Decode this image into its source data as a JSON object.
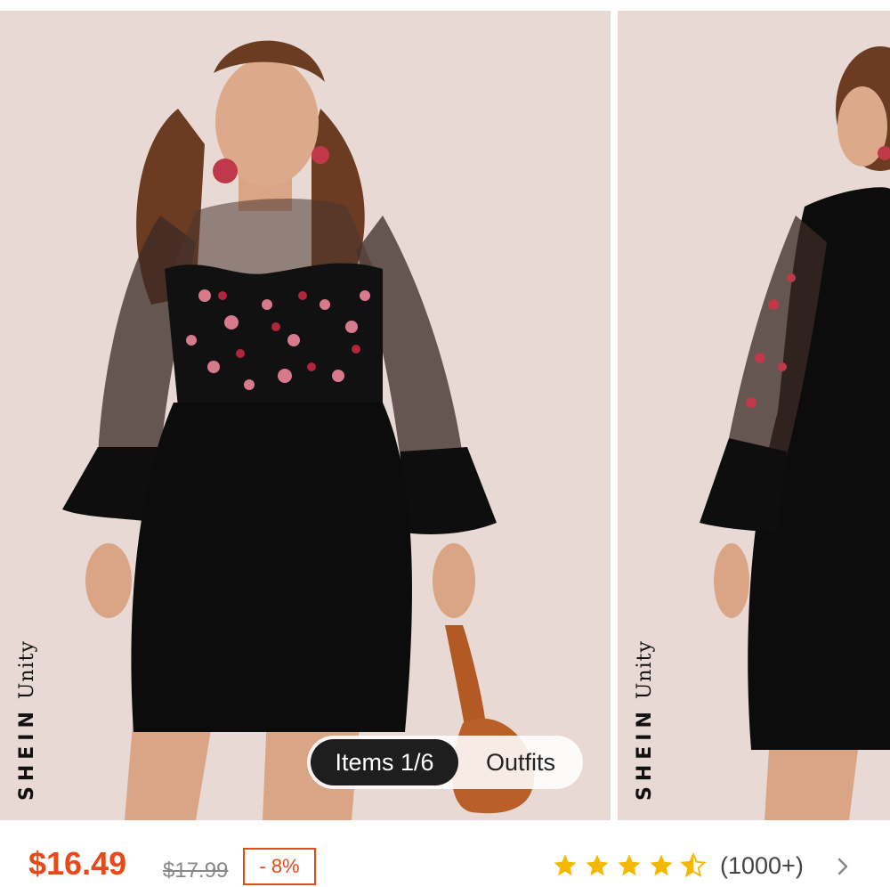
{
  "gallery": {
    "brand_primary": "SHEIN",
    "brand_secondary": "Unity",
    "tabs": {
      "items_label": "Items 1/6",
      "outfits_label": "Outfits"
    }
  },
  "product": {
    "price": "$16.49",
    "original_price": "$17.99",
    "discount": "- 8%",
    "rating_stars": 4.5,
    "reviews": "(1000+)"
  },
  "colors": {
    "accent": "#e64a1a",
    "star": "#f5b800",
    "backdrop": "#e8d9d5"
  }
}
